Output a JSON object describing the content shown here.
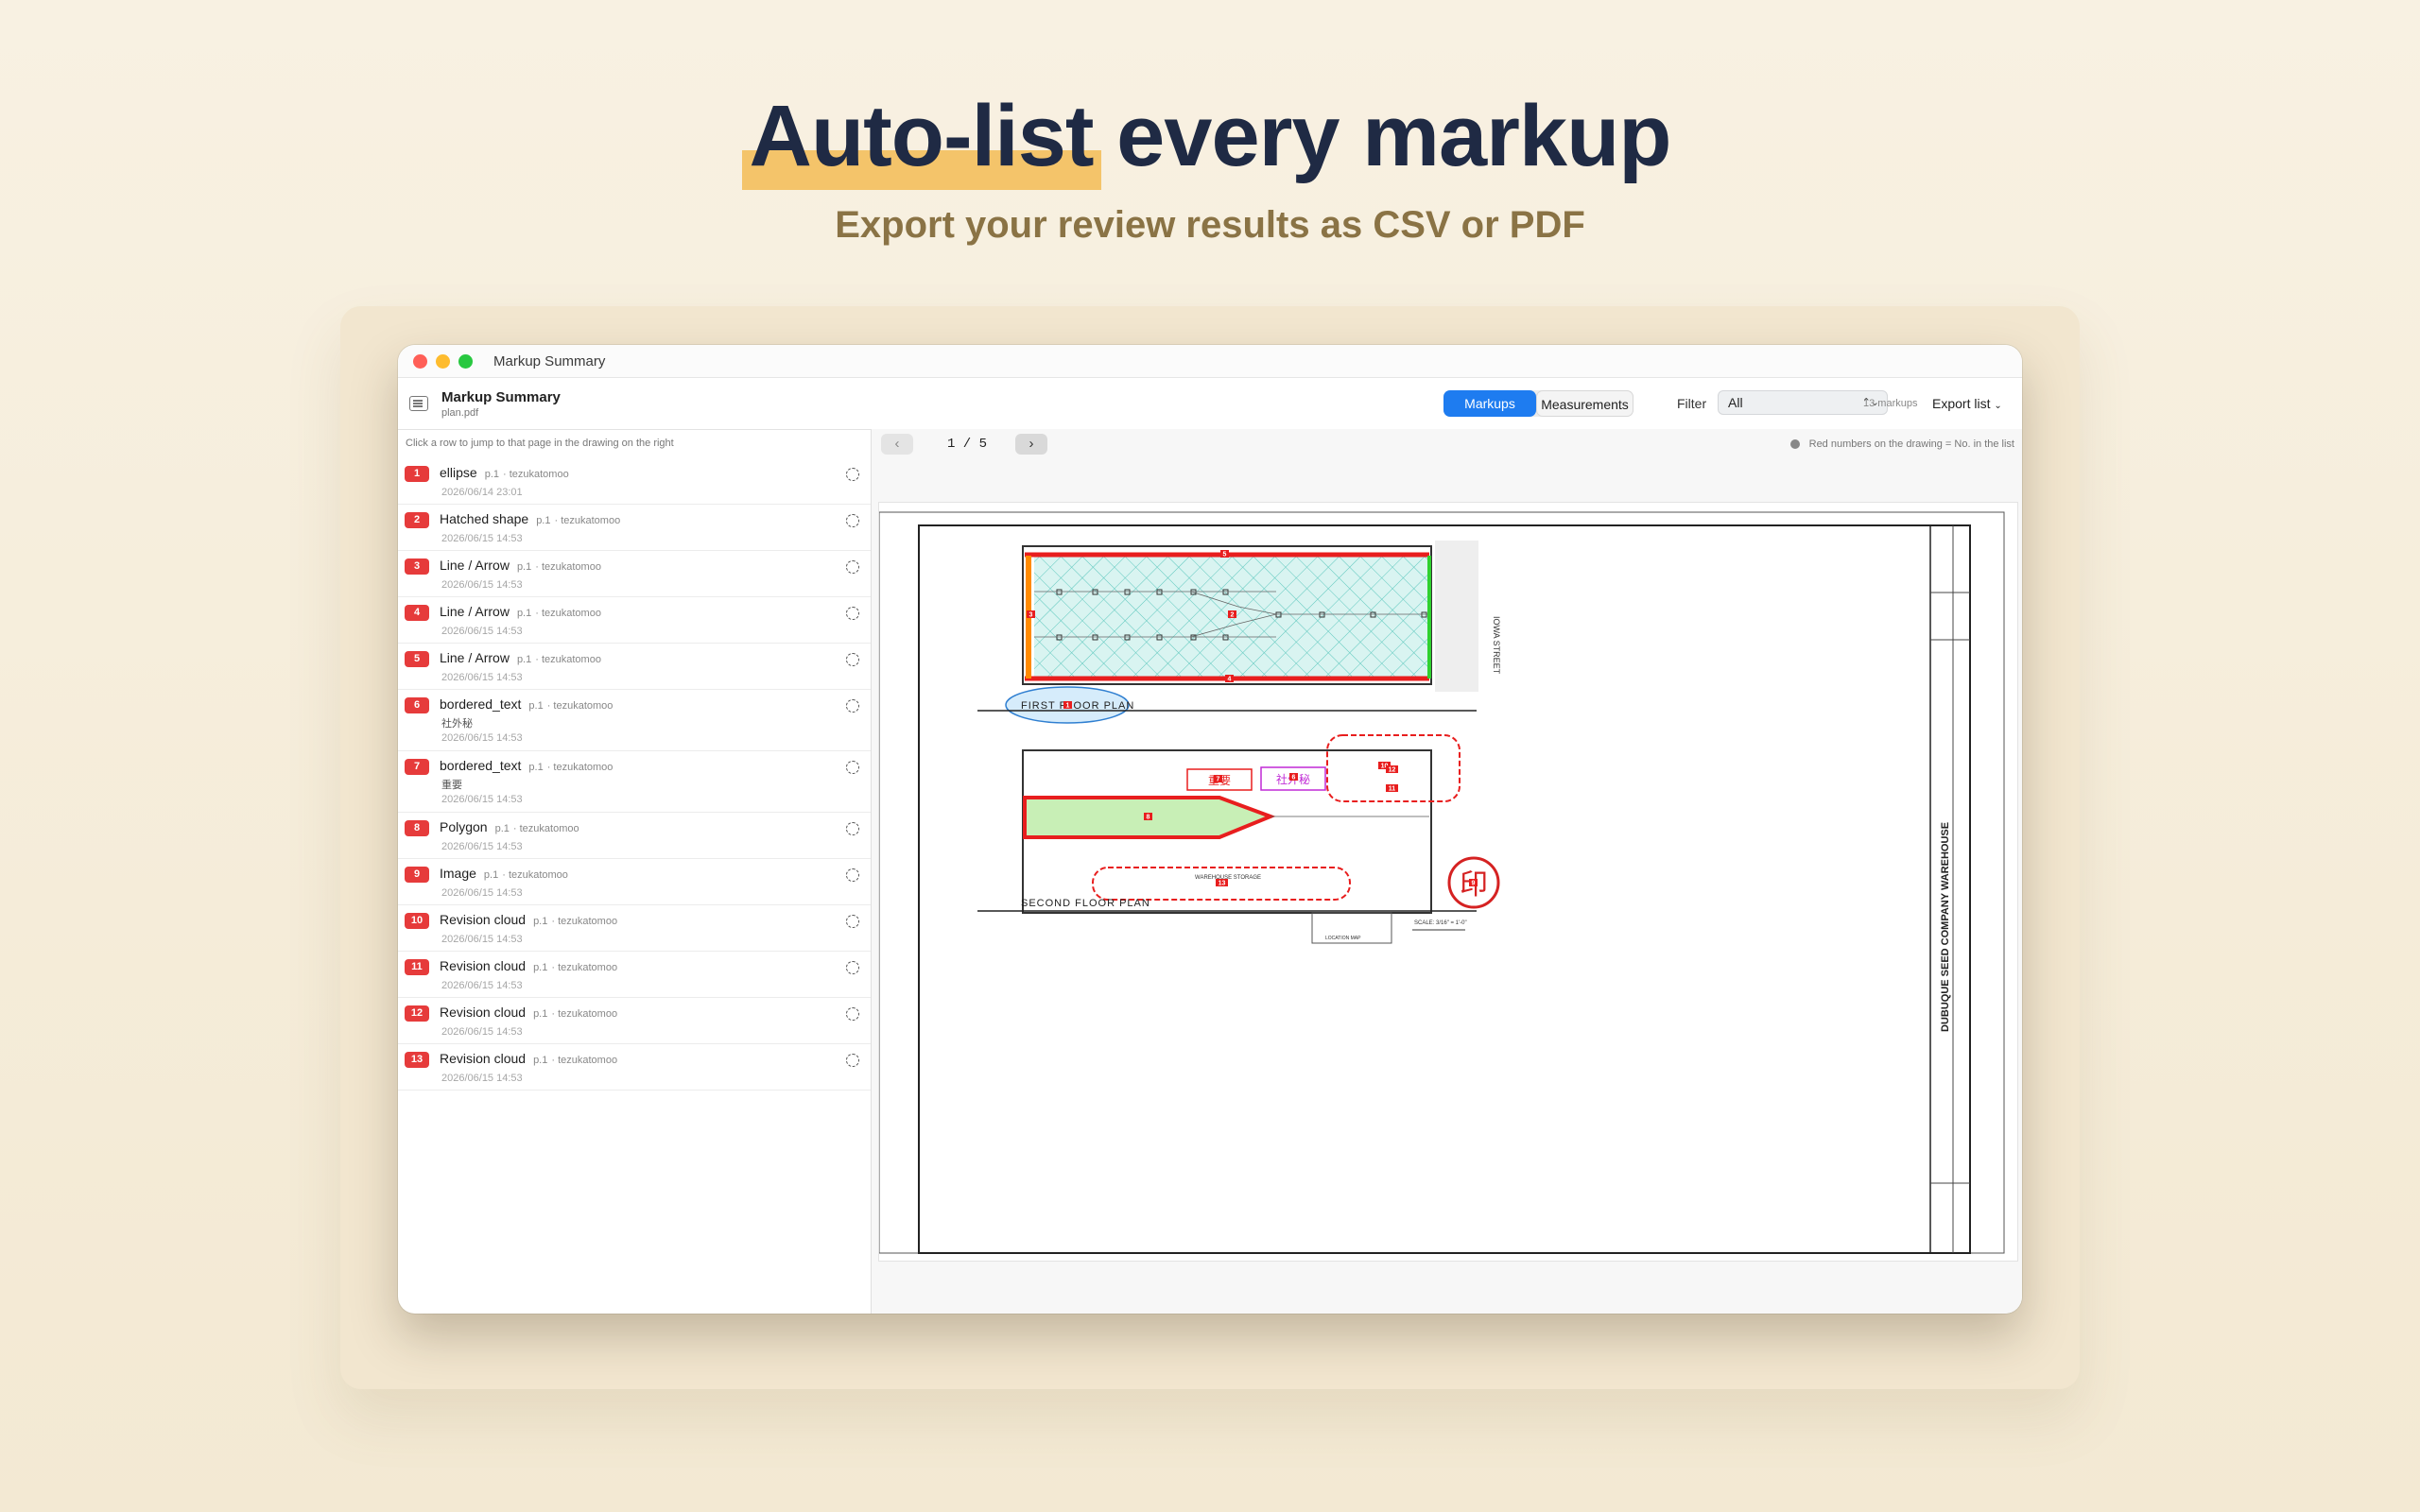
{
  "hero": {
    "title_highlight": "Auto-list",
    "title_rest": " every markup",
    "subtitle": "Export your review results as CSV or PDF"
  },
  "window": {
    "title": "Markup Summary"
  },
  "toolbar": {
    "doc_title": "Markup Summary",
    "doc_file": "plan.pdf",
    "tab_markups": "Markups",
    "tab_measurements": "Measurements",
    "filter_label": "Filter",
    "filter_value": "All",
    "count": "13 markups",
    "export_label": "Export list"
  },
  "list": {
    "hint": "Click a row to jump to that page in the drawing on the right",
    "items": [
      {
        "no": "1",
        "name": "ellipse",
        "page": "p.1",
        "author": "· tezukatomoo",
        "date": "2026/06/14 23:01"
      },
      {
        "no": "2",
        "name": "Hatched shape",
        "page": "p.1",
        "author": "· tezukatomoo",
        "date": "2026/06/15 14:53"
      },
      {
        "no": "3",
        "name": "Line / Arrow",
        "page": "p.1",
        "author": "· tezukatomoo",
        "date": "2026/06/15 14:53"
      },
      {
        "no": "4",
        "name": "Line / Arrow",
        "page": "p.1",
        "author": "· tezukatomoo",
        "date": "2026/06/15 14:53"
      },
      {
        "no": "5",
        "name": "Line / Arrow",
        "page": "p.1",
        "author": "· tezukatomoo",
        "date": "2026/06/15 14:53"
      },
      {
        "no": "6",
        "name": "bordered_text",
        "page": "p.1",
        "author": "· tezukatomoo",
        "sub": "社外秘",
        "date": "2026/06/15 14:53"
      },
      {
        "no": "7",
        "name": "bordered_text",
        "page": "p.1",
        "author": "· tezukatomoo",
        "sub": "重要",
        "date": "2026/06/15 14:53"
      },
      {
        "no": "8",
        "name": "Polygon",
        "page": "p.1",
        "author": "· tezukatomoo",
        "date": "2026/06/15 14:53"
      },
      {
        "no": "9",
        "name": "Image",
        "page": "p.1",
        "author": "· tezukatomoo",
        "date": "2026/06/15 14:53"
      },
      {
        "no": "10",
        "name": "Revision cloud",
        "page": "p.1",
        "author": "· tezukatomoo",
        "date": "2026/06/15 14:53"
      },
      {
        "no": "11",
        "name": "Revision cloud",
        "page": "p.1",
        "author": "· tezukatomoo",
        "date": "2026/06/15 14:53"
      },
      {
        "no": "12",
        "name": "Revision cloud",
        "page": "p.1",
        "author": "· tezukatomoo",
        "date": "2026/06/15 14:53"
      },
      {
        "no": "13",
        "name": "Revision cloud",
        "page": "p.1",
        "author": "· tezukatomoo",
        "date": "2026/06/15 14:53"
      }
    ]
  },
  "viewer": {
    "page_indicator": "1 / 5",
    "note": "Red numbers on the drawing = No. in the list",
    "labels": {
      "first_floor": "FIRST FLOOR PLAN",
      "second_floor": "SECOND FLOOR PLAN",
      "street": "IOWA STREET",
      "company": "DUBUQUE SEED COMPANY WAREHOUSE",
      "stamp_text_7": "重要",
      "stamp_text_6": "社外秘",
      "seal": "印",
      "warehouse": "WAREHOUSE STORAGE",
      "scale": "SCALE: 3/16\" = 1'-0\"",
      "location_map": "LOCATION MAP"
    }
  }
}
